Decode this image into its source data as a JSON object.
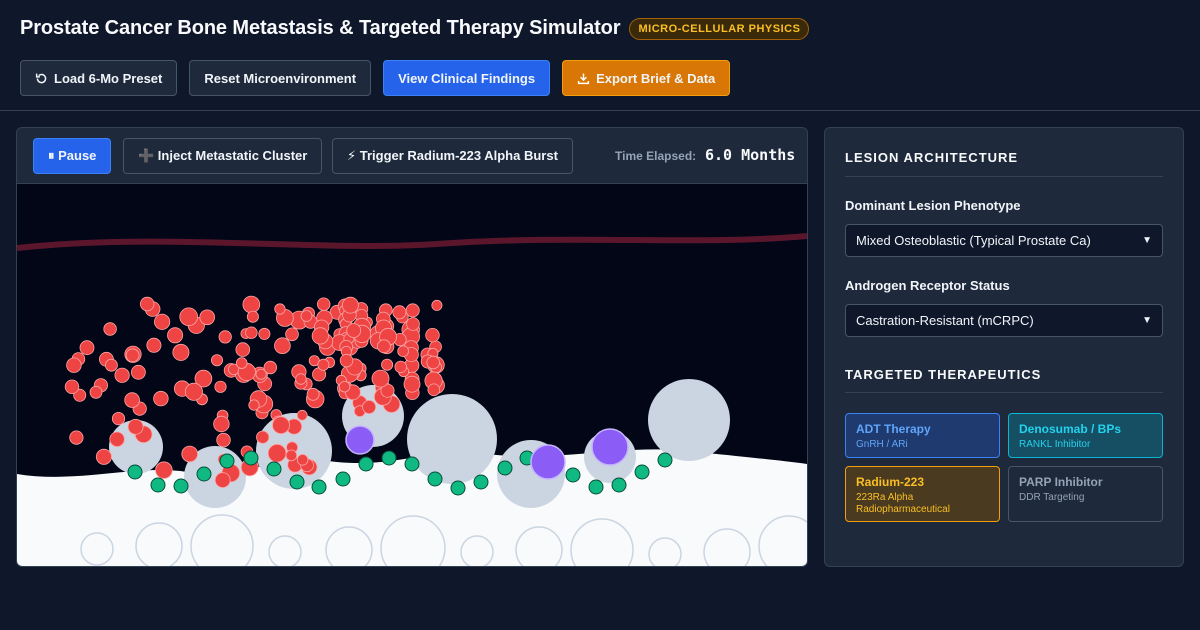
{
  "header": {
    "title": "Prostate Cancer Bone Metastasis & Targeted Therapy Simulator",
    "badge": "MICRO-CELLULAR PHYSICS",
    "buttons": {
      "load_preset": "Load 6-Mo Preset",
      "reset": "Reset Microenvironment",
      "view_findings": "View Clinical Findings",
      "export": "Export Brief & Data"
    }
  },
  "simulation": {
    "pause_label": "⏸ Pause",
    "inject_label": "➕ Inject Metastatic Cluster",
    "radium_label": "⚡ Trigger Radium-223 Alpha Burst",
    "time_label": "Time Elapsed:",
    "time_value": "6.0 Months"
  },
  "sidebar": {
    "lesion_title": "LESION ARCHITECTURE",
    "phenotype_label": "Dominant Lesion Phenotype",
    "phenotype_value": "Mixed Osteoblastic (Typical Prostate Ca)",
    "ar_label": "Androgen Receptor Status",
    "ar_value": "Castration-Resistant (mCRPC)",
    "therapeutics_title": "TARGETED THERAPEUTICS",
    "therapies": [
      {
        "name": "ADT Therapy",
        "sub": "GnRH / ARi"
      },
      {
        "name": "Denosumab / BPs",
        "sub": "RANKL Inhibitor"
      },
      {
        "name": "Radium-223",
        "sub": "223Ra Alpha Radiopharmaceutical"
      },
      {
        "name": "PARP Inhibitor",
        "sub": "DDR Targeting"
      }
    ]
  },
  "colors": {
    "tumor_cell": "#ef4444",
    "osteoblast": "#10b981",
    "osteoclast": "#8b5cf6",
    "bone": "#f8fafc",
    "vessel": "#6b1a30"
  }
}
